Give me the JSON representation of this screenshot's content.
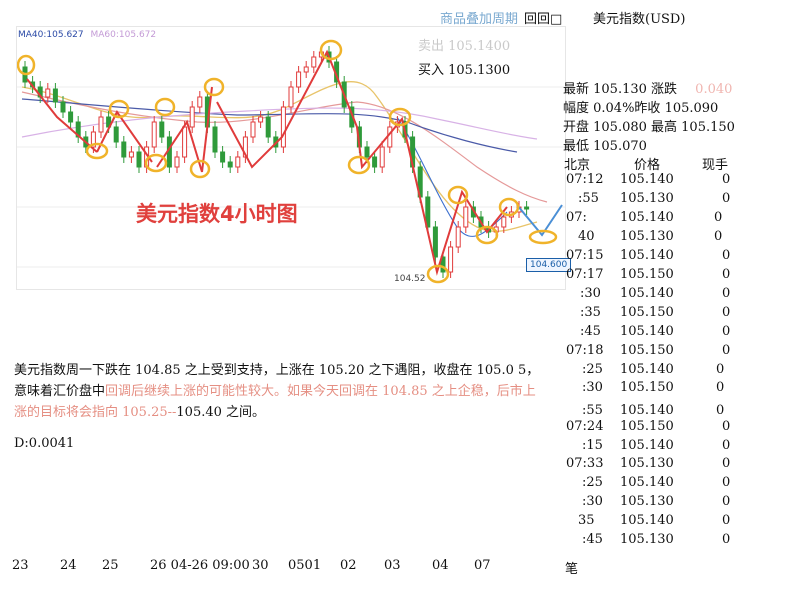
{
  "header": {
    "link": "商品叠加周期",
    "controls": "回回□",
    "title": "美元指数(USD)"
  },
  "ticket": {
    "sell": "卖出 105.1400",
    "buy": "买入 105.1300"
  },
  "quote": {
    "row1_a": "最新 105.130 涨跌",
    "row1_b": "0.040",
    "row2": "幅度  0.04%昨收 105.090",
    "row3": "开盘 105.080 最高 105.150",
    "row4": "最低 105.070"
  },
  "trades_header": {
    "place": "北京",
    "price": "价格",
    "volume": "现手"
  },
  "trades": [
    {
      "time": "07:12",
      "price": "105.140",
      "vol": "0"
    },
    {
      "time": ":55",
      "price": "105.130",
      "vol": "0"
    },
    {
      "time": "07:",
      "price": "105.140",
      "vol": "0"
    },
    {
      "time": "40",
      "price": "105.130",
      "vol": "0"
    },
    {
      "time": "07:15",
      "price": "105.140",
      "vol": "0"
    },
    {
      "time": "07:17",
      "price": "105.150",
      "vol": "0"
    },
    {
      "time": ":30",
      "price": "105.140",
      "vol": "0"
    },
    {
      "time": ":35",
      "price": "105.150",
      "vol": "0"
    },
    {
      "time": ":45",
      "price": "105.140",
      "vol": "0"
    },
    {
      "time": "07:18",
      "price": "105.150",
      "vol": "0"
    },
    {
      "time": ":25",
      "price": "105.140",
      "vol": "0"
    },
    {
      "time": ":30",
      "price": "105.150",
      "vol": "0"
    },
    {
      "time": ":55",
      "price": "105.140",
      "vol": "0"
    },
    {
      "time": "07:24",
      "price": "105.150",
      "vol": "0"
    },
    {
      "time": ":15",
      "price": "105.140",
      "vol": "0"
    },
    {
      "time": "07:33",
      "price": "105.130",
      "vol": "0"
    },
    {
      "time": ":25",
      "price": "105.140",
      "vol": "0"
    },
    {
      "time": ":30",
      "price": "105.130",
      "vol": "0"
    },
    {
      "time": "35",
      "price": "105.140",
      "vol": "0"
    },
    {
      "time": ":45",
      "price": "105.130",
      "vol": "0"
    }
  ],
  "chart": {
    "ma40_label": "MA40:105.627",
    "ma60_label": "MA60:105.672",
    "title": "美元指数4小时图",
    "low_label": "104.52",
    "price_tag": "104.600",
    "up_color": "#e03b3b",
    "down_color": "#2f9a3a"
  },
  "news": {
    "part1": "美元指数周一下跌在 104.85 之上受到支持，上涨在 105.20 之下遇阻，收盘在 105.0 5，意味着汇价盘中",
    "part2": "回调后继续上涨的可能性较大。如果今天回调在 104.85 之上企稳，后市上涨的目标将会指向 105.25--",
    "part3": "105.40 之间。"
  },
  "dval": "D:0.0041",
  "date_axis": [
    "23",
    "24",
    "25",
    "26 04-26 09:00",
    "30",
    "0501",
    "02",
    "03",
    "04",
    "07"
  ],
  "footer_char": "笔"
}
